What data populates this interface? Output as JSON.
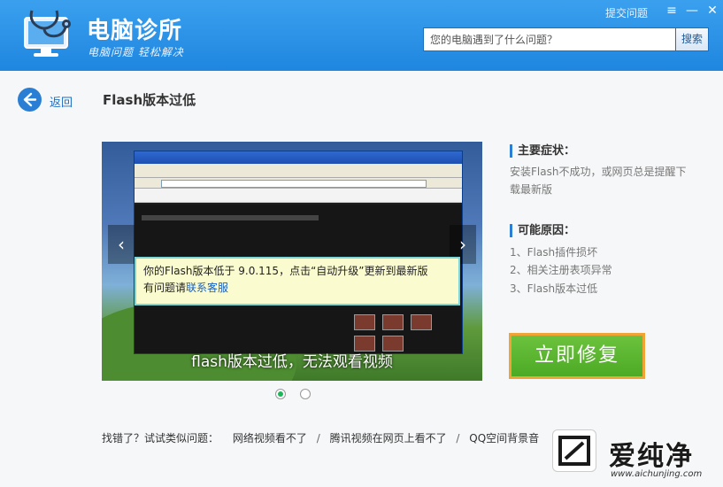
{
  "header": {
    "app_title": "电脑诊所",
    "slogan": "电脑问题 轻松解决",
    "feedback_label": "提交问题",
    "search_placeholder": "您的电脑遇到了什么问题？",
    "search_button": "搜索",
    "window_controls": {
      "menu": "≡",
      "minimize": "—",
      "close": "✕"
    }
  },
  "nav": {
    "back_label": "返回",
    "page_title": "Flash版本过低"
  },
  "carousel": {
    "prev_symbol": "‹",
    "next_symbol": "›",
    "tip_line1": "你的Flash版本低于 9.0.115，点击“自动升级”更新到最新版",
    "tip_line2_prefix": "有问题请",
    "tip_line2_link": "联系客服",
    "caption": "flash版本过低，无法观看视频",
    "slide_count": 2,
    "active_slide": 1
  },
  "symptoms": {
    "heading": "主要症状：",
    "text": "安装Flash不成功，或网页总是提醒下载最新版"
  },
  "causes": {
    "heading": "可能原因：",
    "items": [
      "1、Flash插件损坏",
      "2、相关注册表项异常",
      "3、Flash版本过低"
    ]
  },
  "fix_button": "立即修复",
  "similar": {
    "prefix": "找错了？试试类似问题：",
    "items": [
      "网络视频看不了",
      "腾讯视频在网页上看不了",
      "QQ空间背景音"
    ]
  },
  "watermark": {
    "title": "爱纯净",
    "url": "www.aichunjing.com"
  },
  "colors": {
    "header_blue": "#2a90e6",
    "accent_green": "#55b02e",
    "accent_orange": "#f0a436",
    "link_blue": "#1f6fc0"
  }
}
